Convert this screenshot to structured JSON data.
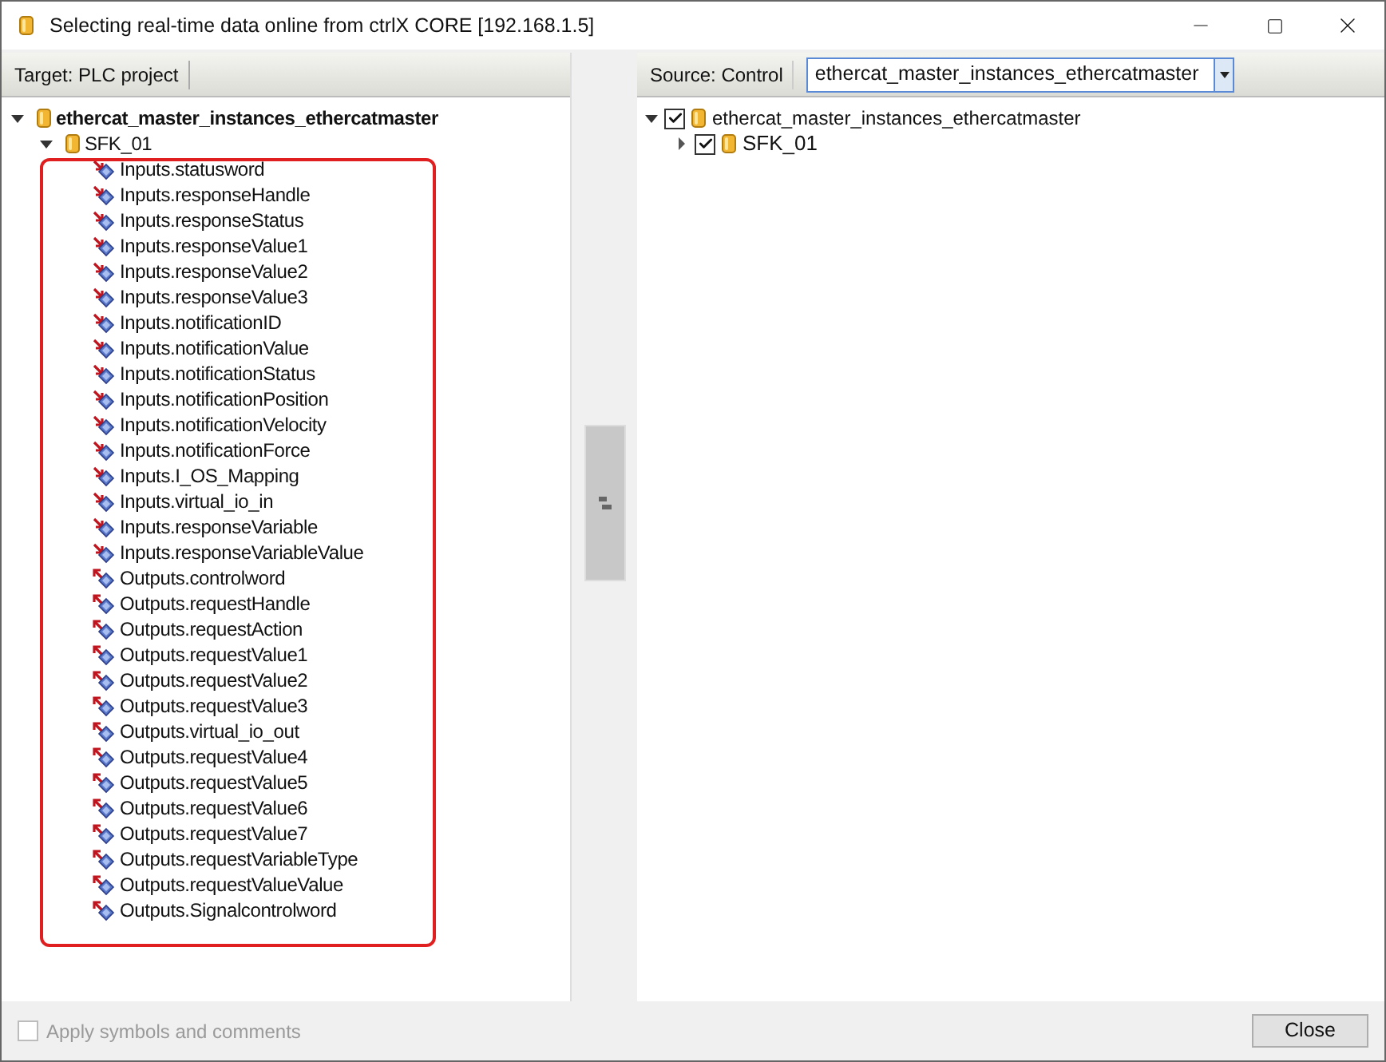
{
  "window": {
    "title": "Selecting real-time data online from ctrlX CORE [192.168.1.5]"
  },
  "target": {
    "label": "Target: PLC project",
    "tree": [
      {
        "label": "ethercat_master_instances_ethercatmaster",
        "expanded": true,
        "children": [
          {
            "label": "SFK_01",
            "expanded": true,
            "children": [
              {
                "label": "Inputs.statusword",
                "kind": "input"
              },
              {
                "label": "Inputs.responseHandle",
                "kind": "input"
              },
              {
                "label": "Inputs.responseStatus",
                "kind": "input"
              },
              {
                "label": "Inputs.responseValue1",
                "kind": "input"
              },
              {
                "label": "Inputs.responseValue2",
                "kind": "input"
              },
              {
                "label": "Inputs.responseValue3",
                "kind": "input"
              },
              {
                "label": "Inputs.notificationID",
                "kind": "input"
              },
              {
                "label": "Inputs.notificationValue",
                "kind": "input"
              },
              {
                "label": "Inputs.notificationStatus",
                "kind": "input"
              },
              {
                "label": "Inputs.notificationPosition",
                "kind": "input"
              },
              {
                "label": "Inputs.notificationVelocity",
                "kind": "input"
              },
              {
                "label": "Inputs.notificationForce",
                "kind": "input"
              },
              {
                "label": "Inputs.I_OS_Mapping",
                "kind": "input"
              },
              {
                "label": "Inputs.virtual_io_in",
                "kind": "input"
              },
              {
                "label": "Inputs.responseVariable",
                "kind": "input"
              },
              {
                "label": "Inputs.responseVariableValue",
                "kind": "input"
              },
              {
                "label": "Outputs.controlword",
                "kind": "output"
              },
              {
                "label": "Outputs.requestHandle",
                "kind": "output"
              },
              {
                "label": "Outputs.requestAction",
                "kind": "output"
              },
              {
                "label": "Outputs.requestValue1",
                "kind": "output"
              },
              {
                "label": "Outputs.requestValue2",
                "kind": "output"
              },
              {
                "label": "Outputs.requestValue3",
                "kind": "output"
              },
              {
                "label": "Outputs.virtual_io_out",
                "kind": "output"
              },
              {
                "label": "Outputs.requestValue4",
                "kind": "output"
              },
              {
                "label": "Outputs.requestValue5",
                "kind": "output"
              },
              {
                "label": "Outputs.requestValue6",
                "kind": "output"
              },
              {
                "label": "Outputs.requestValue7",
                "kind": "output"
              },
              {
                "label": "Outputs.requestVariableType",
                "kind": "output"
              },
              {
                "label": "Outputs.requestValueValue",
                "kind": "output"
              },
              {
                "label": "Outputs.Signalcontrolword",
                "kind": "output"
              }
            ]
          }
        ]
      }
    ]
  },
  "source": {
    "label": "Source: Control",
    "combo_value": "ethercat_master_instances_ethercatmaster",
    "tree": [
      {
        "label": "ethercat_master_instances_ethercatmaster",
        "expanded": true,
        "checked": true,
        "children": [
          {
            "label": "SFK_01",
            "expanded": false,
            "checked": true
          }
        ]
      }
    ]
  },
  "footer": {
    "apply": {
      "label": "Apply symbols and comments",
      "checked": false,
      "disabled": true
    },
    "close_button": "Close"
  }
}
